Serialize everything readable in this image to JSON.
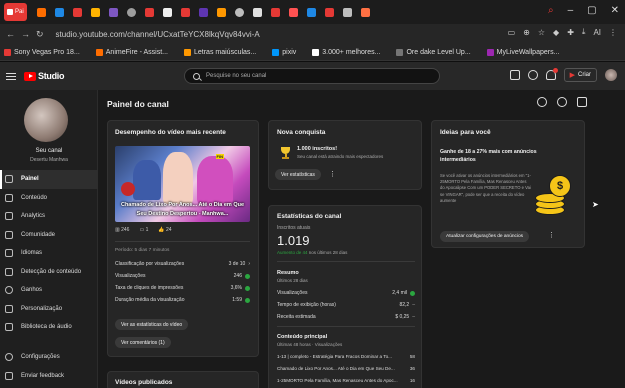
{
  "browser": {
    "active_tab_label": "Pai",
    "url": "studio.youtube.com/channel/UCxatTeYCX8lkqVqv84vvi-A",
    "bookmarks": [
      {
        "label": "Sony Vegas Pro 18...",
        "color": "#e53935"
      },
      {
        "label": "AnimeFire - Assist...",
        "color": "#ff6d00"
      },
      {
        "label": "Letras maiúsculas...",
        "color": "#ff9800"
      },
      {
        "label": "pixiv",
        "color": "#0096fa"
      },
      {
        "label": "3.000+ melhores...",
        "color": "#ffffff"
      },
      {
        "label": "Ore dake Level Up...",
        "color": "#757575"
      },
      {
        "label": "MyLiveWallpapers...",
        "color": "#9c27b0"
      }
    ],
    "url_right_label": "AI"
  },
  "header": {
    "logo_text": "Studio",
    "search_placeholder": "Pesquise no seu canal",
    "create_label": "Criar"
  },
  "sidebar": {
    "channel_title": "Seu canal",
    "channel_name": "Desertu Manhwa",
    "items": [
      {
        "label": "Painel",
        "icon": "dashboard-icon",
        "active": true
      },
      {
        "label": "Conteúdo",
        "icon": "content-icon"
      },
      {
        "label": "Analytics",
        "icon": "analytics-icon"
      },
      {
        "label": "Comunidade",
        "icon": "community-icon"
      },
      {
        "label": "Idiomas",
        "icon": "languages-icon"
      },
      {
        "label": "Detecção de conteúdo",
        "icon": "content-detection-icon"
      },
      {
        "label": "Ganhos",
        "icon": "earn-icon"
      },
      {
        "label": "Personalização",
        "icon": "customization-icon"
      },
      {
        "label": "Biblioteca de áudio",
        "icon": "audio-library-icon"
      }
    ],
    "bottom_items": [
      {
        "label": "Configurações",
        "icon": "settings-icon"
      },
      {
        "label": "Enviar feedback",
        "icon": "feedback-icon"
      }
    ]
  },
  "main": {
    "page_title": "Painel do canal",
    "video_card": {
      "title": "Desempenho do vídeo mais recente",
      "thumbnail_caption": "Chamado de Lixo Por Anos... Até o Dia em Que Seu Destino Despertou - Manhwa...",
      "thumbnail_badge": "FIN",
      "views_stat": "246",
      "comments_stat": "1",
      "likes_stat": "24",
      "period": "Período: 5 dias 7 minutos",
      "metrics": [
        {
          "label": "Classificação por visualizações",
          "value": "3 de 10",
          "status": "chevron"
        },
        {
          "label": "Visualizações",
          "value": "246",
          "status": "ok"
        },
        {
          "label": "Taxa de cliques de impressões",
          "value": "3,6%",
          "status": "ok"
        },
        {
          "label": "Duração média da visualização",
          "value": "1:59",
          "status": "ok"
        }
      ],
      "analytics_button": "Ver as estatísticas do vídeo",
      "comments_button": "Ver comentários (1)"
    },
    "published_card": {
      "title": "Vídeos publicados"
    },
    "achievement_card": {
      "title": "Nova conquista",
      "headline": "1.000 inscritos!",
      "subtitle": "Seu canal está atraindo mais espectadores",
      "button": "Ver estatísticas"
    },
    "stats_card": {
      "title": "Estatísticas do canal",
      "subs_label": "Inscritos atuais",
      "subs_value": "1.019",
      "subs_delta": "Aumento de 44",
      "subs_delta_suffix": "nos últimos 28 dias",
      "summary_title": "Resumo",
      "summary_period": "Últimos 28 dias",
      "summary_rows": [
        {
          "label": "Visualizações",
          "value": "2,4 mil"
        },
        {
          "label": "Tempo de exibição (horas)",
          "value": "82,2"
        },
        {
          "label": "Receita estimada",
          "value": "$ 0,25"
        }
      ],
      "top_title": "Conteúdo principal",
      "top_period": "Últimas 48 horas · Visualizações",
      "top_rows": [
        {
          "label": "1-13 | completo - Estratégia Para Fracos Dominar a To...",
          "value": "58"
        },
        {
          "label": "Chamado de Lixo Por Anos... Até o Dia em Que Seu De...",
          "value": "36"
        },
        {
          "label": "1-25MORTO Pela Família, Mas Renasceu Antes do Apoc...",
          "value": "16"
        }
      ]
    },
    "ideas_card": {
      "title": "Ideias para você",
      "headline": "Ganhe de 18 a 27% mais com anúncios intermediários",
      "body": "Se você ativar os anúncios intermediários em \"1-25MORTO Pela Família, Mas Renasceu Antes do Apocalipse Com um PODER SECRETO e Vai se VINGAR\", pode ser que a receita do vídeo aumente",
      "button": "Atualizar configurações de anúncios"
    }
  },
  "colors": {
    "accent_red": "#ff0000",
    "ok_green": "#2ba640",
    "coin_gold": "#f5c518"
  }
}
